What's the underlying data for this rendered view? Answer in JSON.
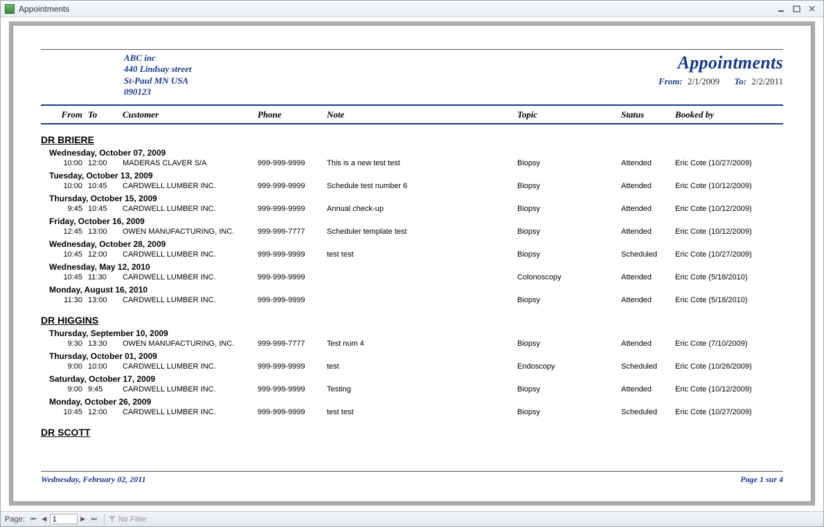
{
  "window": {
    "title": "Appointments"
  },
  "company": {
    "name": "ABC inc",
    "street": "440 Lindsay street",
    "citystate": "St-Paul MN USA",
    "zip": "090123"
  },
  "report": {
    "title": "Appointments",
    "from_label": "From:",
    "from_value": "2/1/2009",
    "to_label": "To:",
    "to_value": "2/2/2011"
  },
  "columns": {
    "from": "From",
    "to": "To",
    "customer": "Customer",
    "phone": "Phone",
    "note": "Note",
    "topic": "Topic",
    "status": "Status",
    "booked_by": "Booked by"
  },
  "groups": [
    {
      "doctor": "DR BRIERE",
      "dates": [
        {
          "label": "Wednesday, October 07, 2009",
          "rows": [
            {
              "from": "10:00",
              "to": "12:00",
              "customer": "MADERAS CLAVER S/A",
              "phone": "999-999-9999",
              "note": "This is a new test test",
              "topic": "Biopsy",
              "status": "Attended",
              "booked_by": "Eric Cote (10/27/2009)"
            }
          ]
        },
        {
          "label": "Tuesday, October 13, 2009",
          "rows": [
            {
              "from": "10:00",
              "to": "10:45",
              "customer": "CARDWELL LUMBER INC.",
              "phone": "999-999-9999",
              "note": "Schedule test number 6",
              "topic": "Biopsy",
              "status": "Attended",
              "booked_by": "Eric Cote (10/12/2009)"
            }
          ]
        },
        {
          "label": "Thursday, October 15, 2009",
          "rows": [
            {
              "from": "9:45",
              "to": "10:45",
              "customer": "CARDWELL LUMBER INC.",
              "phone": "999-999-9999",
              "note": "Annual check-up",
              "topic": "Biopsy",
              "status": "Attended",
              "booked_by": "Eric Cote (10/12/2009)"
            }
          ]
        },
        {
          "label": "Friday, October 16, 2009",
          "rows": [
            {
              "from": "12:45",
              "to": "13:00",
              "customer": "OWEN MANUFACTURING, INC.",
              "phone": "999-999-7777",
              "note": "Scheduler template test",
              "topic": "Biopsy",
              "status": "Attended",
              "booked_by": "Eric Cote (10/12/2009)"
            }
          ]
        },
        {
          "label": "Wednesday, October 28, 2009",
          "rows": [
            {
              "from": "10:45",
              "to": "12:00",
              "customer": "CARDWELL LUMBER INC.",
              "phone": "999-999-9999",
              "note": "test test",
              "topic": "Biopsy",
              "status": "Scheduled",
              "booked_by": "Eric Cote (10/27/2009)"
            }
          ]
        },
        {
          "label": "Wednesday, May 12, 2010",
          "rows": [
            {
              "from": "10:45",
              "to": "11:30",
              "customer": "CARDWELL LUMBER INC.",
              "phone": "999-999-9999",
              "note": "",
              "topic": "Colonoscopy",
              "status": "Attended",
              "booked_by": "Eric Cote (5/18/2010)"
            }
          ]
        },
        {
          "label": "Monday, August 16, 2010",
          "rows": [
            {
              "from": "11:30",
              "to": "13:00",
              "customer": "CARDWELL LUMBER INC.",
              "phone": "999-999-9999",
              "note": "",
              "topic": "Biopsy",
              "status": "Attended",
              "booked_by": "Eric Cote (5/18/2010)"
            }
          ]
        }
      ]
    },
    {
      "doctor": "DR HIGGINS",
      "dates": [
        {
          "label": "Thursday, September 10, 2009",
          "rows": [
            {
              "from": "9:30",
              "to": "13:30",
              "customer": "OWEN MANUFACTURING, INC.",
              "phone": "999-999-7777",
              "note": "Test num 4",
              "topic": "Biopsy",
              "status": "Attended",
              "booked_by": "Eric Cote (7/10/2009)"
            }
          ]
        },
        {
          "label": "Thursday, October 01, 2009",
          "rows": [
            {
              "from": "9:00",
              "to": "10:00",
              "customer": "CARDWELL LUMBER INC.",
              "phone": "999-999-9999",
              "note": "test",
              "topic": "Endoscopy",
              "status": "Scheduled",
              "booked_by": "Eric Cote (10/26/2009)"
            }
          ]
        },
        {
          "label": "Saturday, October 17, 2009",
          "rows": [
            {
              "from": "9:00",
              "to": "9:45",
              "customer": "CARDWELL LUMBER INC.",
              "phone": "999-999-9999",
              "note": "Testing",
              "topic": "Biopsy",
              "status": "Attended",
              "booked_by": "Eric Cote (10/12/2009)"
            }
          ]
        },
        {
          "label": "Monday, October 26, 2009",
          "rows": [
            {
              "from": "10:45",
              "to": "12:00",
              "customer": "CARDWELL LUMBER INC.",
              "phone": "999-999-9999",
              "note": "test test",
              "topic": "Biopsy",
              "status": "Scheduled",
              "booked_by": "Eric Cote (10/27/2009)"
            }
          ]
        }
      ]
    },
    {
      "doctor": "DR SCOTT",
      "dates": []
    }
  ],
  "footer": {
    "date": "Wednesday, February 02, 2011",
    "page": "Page 1 sur 4"
  },
  "statusbar": {
    "page_label": "Page:",
    "page_value": "1",
    "no_filter": "No Filter"
  }
}
